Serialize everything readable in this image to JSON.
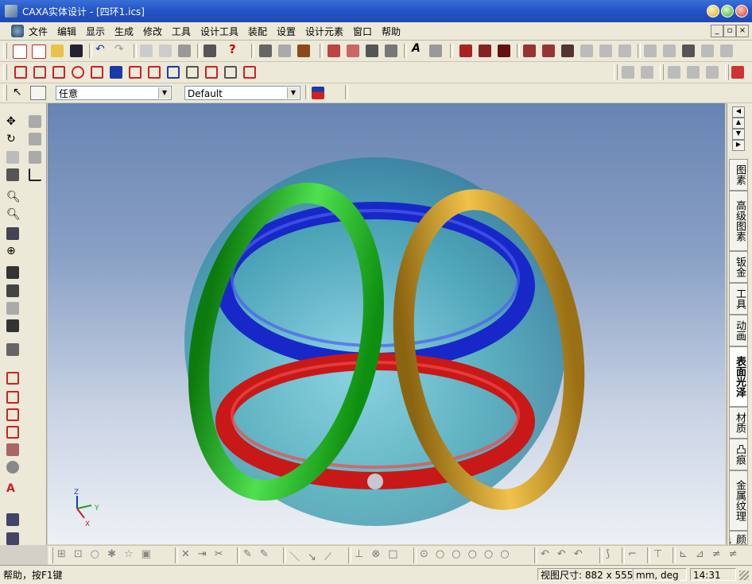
{
  "window": {
    "title": "CAXA实体设计 - [四环1.ics]"
  },
  "menubar": {
    "items": [
      "文件",
      "编辑",
      "显示",
      "生成",
      "修改",
      "工具",
      "设计工具",
      "装配",
      "设置",
      "设计元素",
      "窗口",
      "帮助"
    ]
  },
  "toolbar3": {
    "filter_value": "任意",
    "style_value": "Default"
  },
  "right_tabs": [
    "图素",
    "高级图素",
    "钣金",
    "工具",
    "动画",
    "表面光泽",
    "材质",
    "凸痕",
    "金属纹理",
    "颜色"
  ],
  "triad": {
    "x_label": "X",
    "y_label": "Y",
    "z_label": "Z"
  },
  "statusbar": {
    "help": "帮助，按F1键",
    "view_size": "视图尺寸: 882 x 555",
    "units": "mm, deg",
    "time": "14:31"
  },
  "colors": {
    "ring_green": "#1fb01f",
    "ring_gold": "#c89a1e",
    "ring_blue": "#1828c8",
    "ring_red": "#c81818",
    "sphere": "#3aa6b4",
    "titlebar": "#2455c8"
  },
  "icons": {
    "app": "caxa-app-icon",
    "minimize": "minimize-icon",
    "maximize": "maximize-icon",
    "close": "close-icon"
  }
}
